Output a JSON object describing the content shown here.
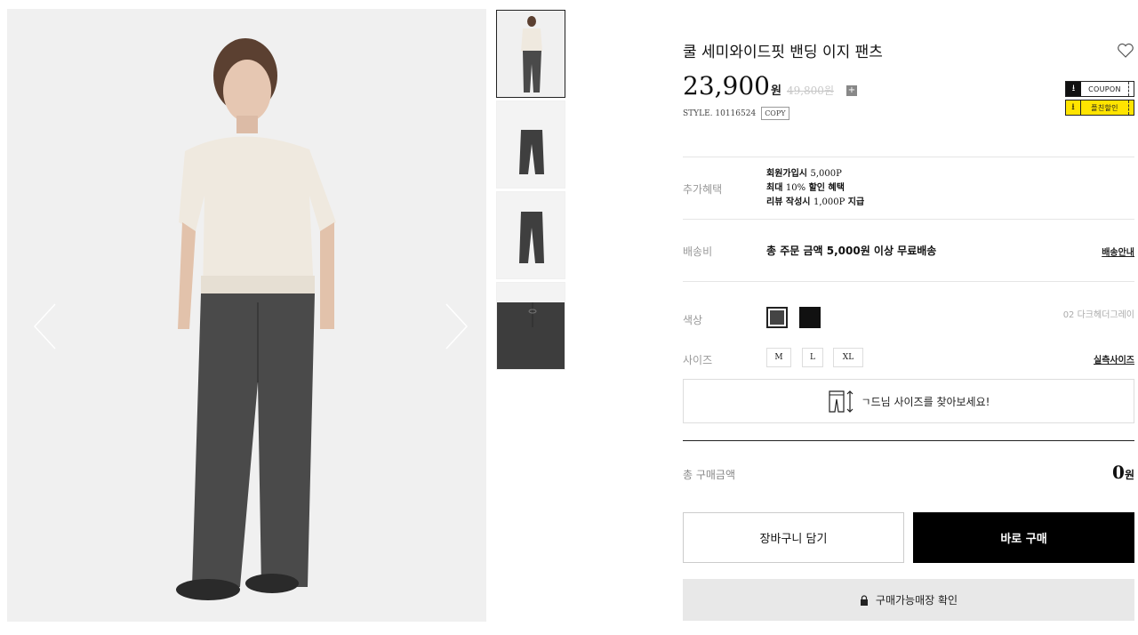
{
  "gallery": {
    "main_image_alt": "model-wearing-pants",
    "prev_icon": "chevron-left-icon",
    "next_icon": "chevron-right-icon",
    "thumbnails": [
      "model-full-view",
      "pants-front",
      "pants-back",
      "waistband-detail"
    ]
  },
  "product": {
    "title": "쿨 세미와이드핏 밴딩 이지 팬츠",
    "price": "23,900",
    "price_unit": "원",
    "original_price": "49,800원",
    "plus_icon": "+",
    "style_label": "STYLE. 10116524",
    "copy_label": "COPY"
  },
  "coupons": [
    {
      "label": "COUPON",
      "icon": "download-icon"
    },
    {
      "label": "플친할인",
      "icon": "download-icon"
    }
  ],
  "benefits": {
    "label": "추가혜택",
    "lines": [
      {
        "text_a": "회원가입시 ",
        "num": "5,000P",
        "text_b": ""
      },
      {
        "text_a": "최대 ",
        "num": "10%",
        "text_b": " 할인 혜택"
      },
      {
        "text_a": "리뷰 작성시 ",
        "num": "1,000P",
        "text_b": " 지급"
      }
    ]
  },
  "shipping": {
    "label": "배송비",
    "text": "총 주문 금액 5,000원 이상 무료배송",
    "link": "배송안내"
  },
  "color": {
    "label": "색상",
    "selected_name": "02 다크헤더그레이",
    "swatches": [
      "#444444",
      "#111111"
    ]
  },
  "size": {
    "label": "사이즈",
    "options": [
      "M",
      "L",
      "XL"
    ],
    "link": "실측사이즈"
  },
  "finder": {
    "text": "ㄱ드님 사이즈를 찾아보세요!",
    "icon": "pants-size-icon"
  },
  "total": {
    "label": "총 구매금액",
    "value": "0",
    "unit": "원"
  },
  "actions": {
    "cart": "장바구니 담기",
    "buy": "바로 구매",
    "store": "구매가능매장 확인"
  }
}
